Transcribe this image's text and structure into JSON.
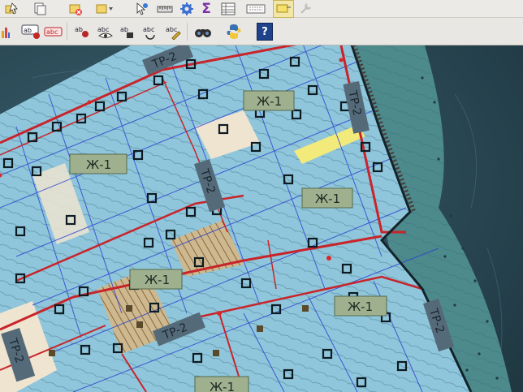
{
  "toolbar": {
    "sigma_label": "Σ",
    "help_label": "?"
  },
  "map": {
    "zone_label": "Ж-1",
    "transport_label": "ТР-2"
  },
  "colors": {
    "water": "#2f4f5c",
    "land_blue": "#8fc6db",
    "parcel_red": "#c8242a",
    "line_blue": "#2a3fd0",
    "highlight_yellow": "#f2ea7a",
    "label_bg": "#9fb08f",
    "tr_label_bg": "#556a78"
  }
}
